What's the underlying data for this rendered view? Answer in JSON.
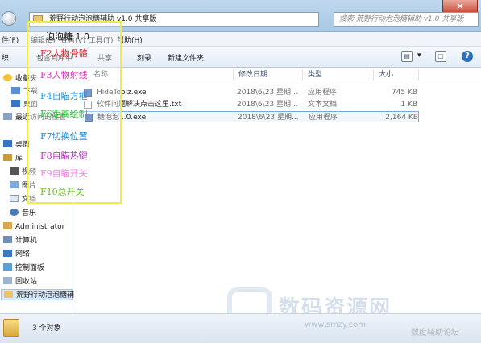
{
  "window": {
    "address_path": "荒野行动泡泡糖辅助 v1.0 共享版",
    "search_placeholder": "搜索 荒野行动泡泡糖辅助 v1.0 共享版",
    "close_glyph": "✕"
  },
  "menubar": {
    "items": [
      "件(F)",
      "编辑(E)",
      "查看(V)",
      "工具(T)",
      "帮助(H)"
    ]
  },
  "toolbar": {
    "organize": "织",
    "include_in_library": "包含到库中",
    "share": "共享",
    "burn": "刻录",
    "new_folder": "新建文件夹",
    "help_glyph": "?"
  },
  "navpane": {
    "items": [
      {
        "label": "收藏夹",
        "icon": "star-icon"
      },
      {
        "label": "下载",
        "icon": "download-icon"
      },
      {
        "label": "桌面",
        "icon": "desktop-icon"
      },
      {
        "label": "最近访问的位置",
        "icon": "recent-places-icon"
      },
      {
        "label": "桌面",
        "icon": "desktop-icon"
      },
      {
        "label": "库",
        "icon": "library-icon"
      },
      {
        "label": "视频",
        "icon": "video-icon"
      },
      {
        "label": "图片",
        "icon": "picture-icon"
      },
      {
        "label": "文档",
        "icon": "document-icon"
      },
      {
        "label": "音乐",
        "icon": "music-icon"
      },
      {
        "label": "Administrator",
        "icon": "user-icon"
      },
      {
        "label": "计算机",
        "icon": "computer-icon"
      },
      {
        "label": "网络",
        "icon": "network-icon"
      },
      {
        "label": "控制面板",
        "icon": "control-panel-icon"
      },
      {
        "label": "回收站",
        "icon": "recycle-bin-icon"
      },
      {
        "label": "荒野行动泡泡糖辅",
        "icon": "folder-icon"
      }
    ]
  },
  "filelist": {
    "columns": [
      "名称",
      "修改日期",
      "类型",
      "大小"
    ],
    "rows": [
      {
        "name": "HideToolz.exe",
        "date": "2018\\6\\23 星期...",
        "type": "应用程序",
        "size": "745 KB",
        "icon": "exe-icon"
      },
      {
        "name": "软件问题解决点击这里.txt",
        "date": "2018\\6\\23 星期...",
        "type": "文本文档",
        "size": "1 KB",
        "icon": "txt-icon"
      },
      {
        "name": "糖泡泡...0.exe",
        "date": "2018\\6\\23 星期...",
        "type": "应用程序",
        "size": "2,164 KB",
        "icon": "exe-icon"
      }
    ]
  },
  "overlay": {
    "title": "泡泡糖 1.0",
    "hotkeys": [
      {
        "label": "F2人物骨骼",
        "color": "#e8202a"
      },
      {
        "label": "F3人物射线",
        "color": "#d52fb5"
      },
      {
        "label": "F4自瞄方框",
        "color": "#2a92e0"
      },
      {
        "label": "F6距离绘制",
        "color": "#20c030"
      },
      {
        "label": "F7切换位置",
        "color": "#1a8ad8"
      },
      {
        "label": "F8自瞄热键",
        "color": "#b22fc0"
      },
      {
        "label": "F9自瞄开关",
        "color": "#f080e0"
      },
      {
        "label": "F10总开关",
        "color": "#66bb22"
      }
    ]
  },
  "statusbar": {
    "count": "3 个对象"
  },
  "watermark": {
    "text": "数码资源网",
    "url": "www.smzy.com",
    "corner": "数度辅助论坛"
  }
}
